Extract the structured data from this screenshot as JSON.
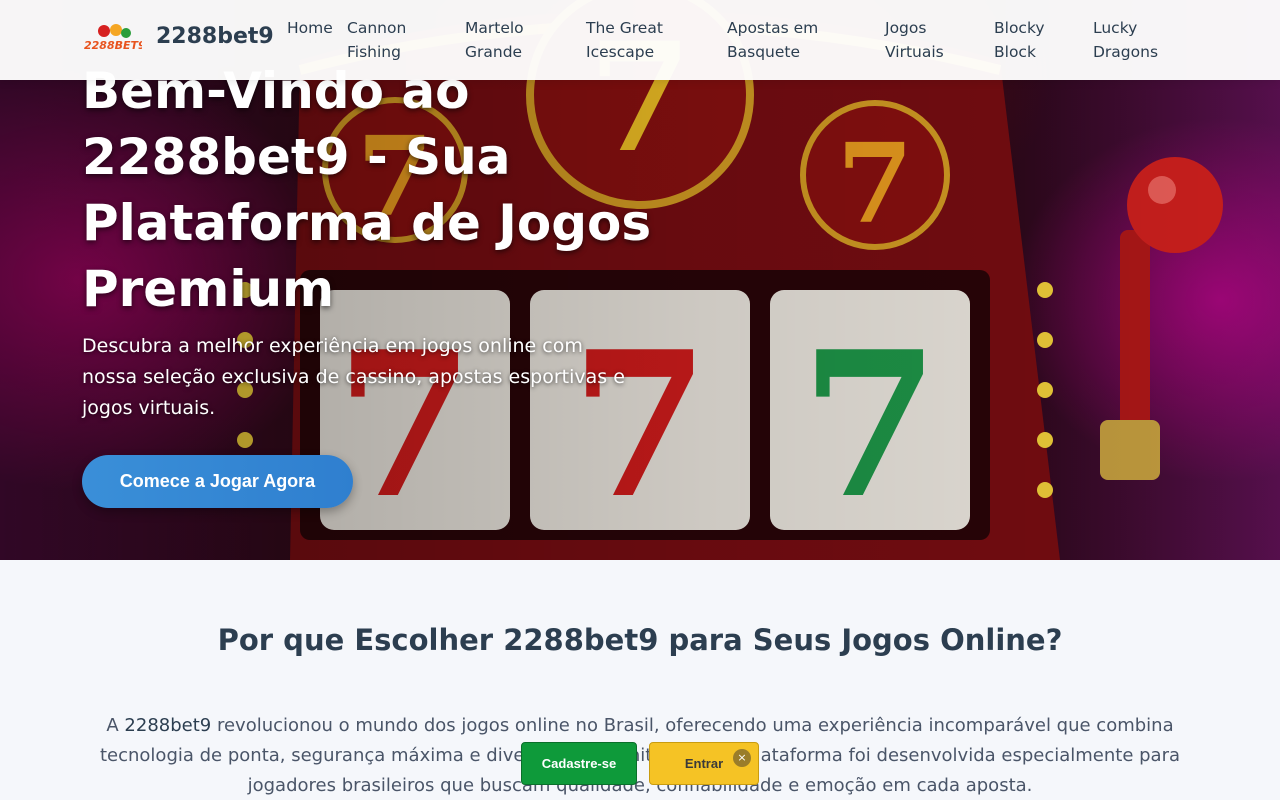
{
  "header": {
    "logo_text": "2288BET9",
    "brand": "2288bet9",
    "nav": [
      {
        "label": "Home"
      },
      {
        "label": "Cannon Fishing"
      },
      {
        "label": "Martelo Grande"
      },
      {
        "label": "The Great Icescape"
      },
      {
        "label": "Apostas em Basquete"
      },
      {
        "label": "Jogos Virtuais"
      },
      {
        "label": "Blocky Block"
      },
      {
        "label": "Lucky Dragons"
      }
    ]
  },
  "hero": {
    "title": "Bem-Vindo ao 2288bet9 - Sua Plataforma de Jogos Premium",
    "description": "Descubra a melhor experiência em jogos online com nossa seleção exclusiva de cassino, apostas esportivas e jogos virtuais.",
    "cta": "Comece a Jogar Agora"
  },
  "why": {
    "title": "Por que Escolher 2288bet9 para Seus Jogos Online?",
    "text_before": "A ",
    "brand": "2288bet9",
    "text_after": " revolucionou o mundo dos jogos online no Brasil, oferecendo uma experiência incomparável que combina tecnologia de ponta, segurança máxima e diversão sem limites. Nossa plataforma foi desenvolvida especialmente para jogadores brasileiros que buscam qualidade, confiabilidade e emoção em cada aposta."
  },
  "floating_bar": {
    "register": "Cadastre-se",
    "login": "Entrar",
    "close": "×"
  },
  "colors": {
    "header_text": "#2c3e50",
    "cta": "#3a8fd8",
    "register": "#0e9a3a",
    "login": "#f5c325"
  }
}
